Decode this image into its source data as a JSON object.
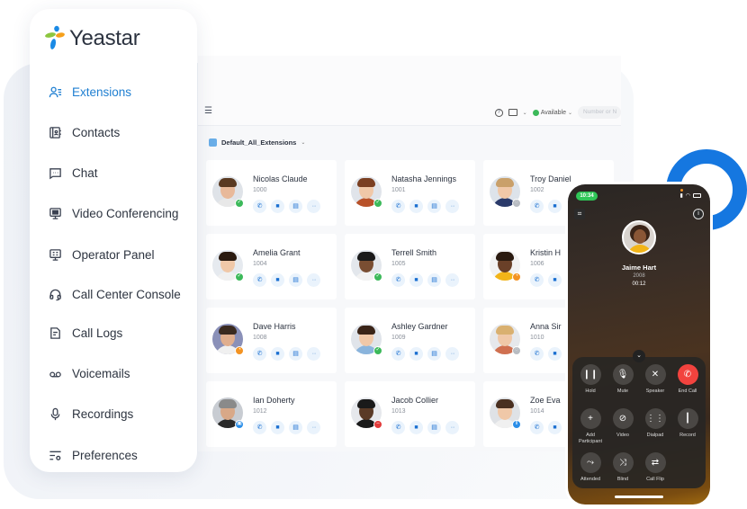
{
  "brand": {
    "name": "Yeastar",
    "colors": {
      "accent": "#1f7fd1",
      "logo_green": "#8cc63f",
      "logo_orange": "#f6a01a",
      "logo_blue": "#1a8ae5"
    }
  },
  "sidebar": {
    "items": [
      {
        "label": "Extensions",
        "icon": "extensions-icon",
        "active": true
      },
      {
        "label": "Contacts",
        "icon": "contacts-icon"
      },
      {
        "label": "Chat",
        "icon": "chat-icon"
      },
      {
        "label": "Video Conferencing",
        "icon": "video-conferencing-icon"
      },
      {
        "label": "Operator Panel",
        "icon": "operator-panel-icon"
      },
      {
        "label": "Call Center Console",
        "icon": "headset-icon"
      },
      {
        "label": "Call Logs",
        "icon": "call-logs-icon"
      },
      {
        "label": "Voicemails",
        "icon": "voicemail-icon"
      },
      {
        "label": "Recordings",
        "icon": "microphone-icon"
      },
      {
        "label": "Preferences",
        "icon": "preferences-icon"
      }
    ]
  },
  "topbar": {
    "status": "Available",
    "search_placeholder": "Number or N",
    "status_color": "#3cb95a"
  },
  "group": {
    "selected": "Default_All_Extensions"
  },
  "extensions": [
    {
      "name": "Nicolas Claude",
      "ext": "1000",
      "status": "available"
    },
    {
      "name": "Natasha Jennings",
      "ext": "1001",
      "status": "available"
    },
    {
      "name": "Troy Daniel",
      "ext": "1002",
      "status": "offline"
    },
    {
      "name": "Amelia Grant",
      "ext": "1004",
      "status": "available"
    },
    {
      "name": "Terrell Smith",
      "ext": "1005",
      "status": "available"
    },
    {
      "name": "Kristin H",
      "ext": "1006",
      "status": "away"
    },
    {
      "name": "Dave Harris",
      "ext": "1008",
      "status": "away"
    },
    {
      "name": "Ashley Gardner",
      "ext": "1009",
      "status": "available"
    },
    {
      "name": "Anna Sir",
      "ext": "1010",
      "status": "offline"
    },
    {
      "name": "Ian Doherty",
      "ext": "1012",
      "status": "business-trip"
    },
    {
      "name": "Jacob Collier",
      "ext": "1013",
      "status": "do-not-disturb"
    },
    {
      "name": "Zoe Eva",
      "ext": "1014",
      "status": "on-call"
    }
  ],
  "status_colors": {
    "available": "#3cb95a",
    "away": "#f39322",
    "offline": "#b8bcc2",
    "business-trip": "#2b8ee8",
    "do-not-disturb": "#e23b3b",
    "on-call": "#2b8ee8"
  },
  "phone": {
    "time": "10:34",
    "caller": {
      "name": "Jaime Hart",
      "ext": "2008",
      "duration": "00:12"
    },
    "controls": [
      {
        "label": "Hold",
        "icon": "pause-icon"
      },
      {
        "label": "Mute",
        "icon": "microphone-icon"
      },
      {
        "label": "Speaker",
        "icon": "speaker-off-icon"
      },
      {
        "label": "End Call",
        "icon": "end-call-icon"
      },
      {
        "label": "Add Participant",
        "icon": "add-participant-icon"
      },
      {
        "label": "Video",
        "icon": "video-off-icon"
      },
      {
        "label": "Dialpad",
        "icon": "dialpad-icon"
      },
      {
        "label": "Record",
        "icon": "record-icon"
      },
      {
        "label": "Attended",
        "icon": "attended-transfer-icon"
      },
      {
        "label": "Blind",
        "icon": "blind-transfer-icon"
      },
      {
        "label": "Call Flip",
        "icon": "call-flip-icon"
      }
    ]
  }
}
